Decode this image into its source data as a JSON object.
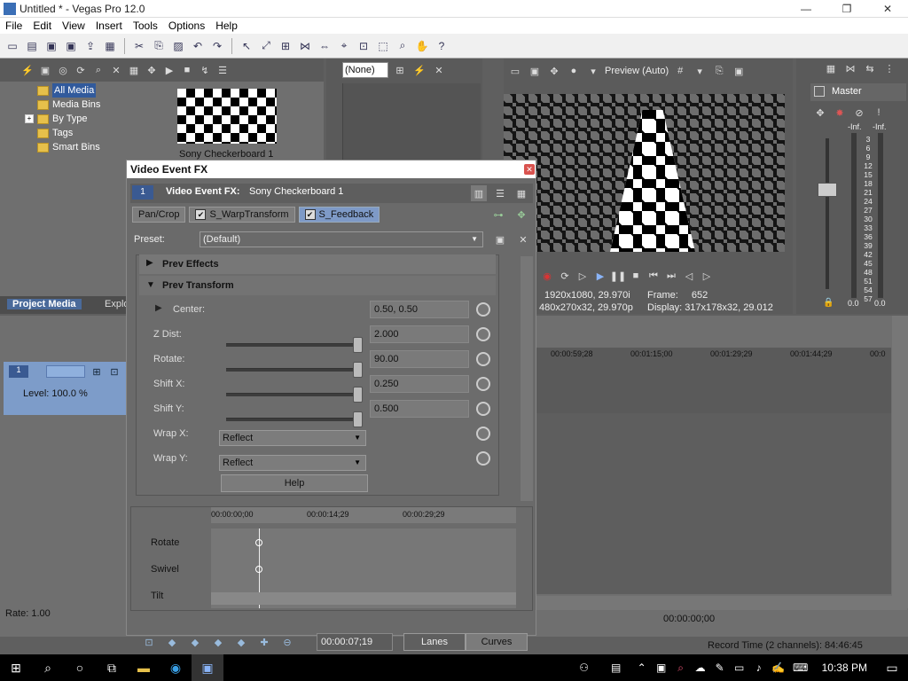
{
  "window": {
    "title": "Untitled * - Vegas Pro 12.0",
    "minimize": "—",
    "maximize": "❐",
    "close": "✕"
  },
  "menu": [
    "File",
    "Edit",
    "View",
    "Insert",
    "Tools",
    "Options",
    "Help"
  ],
  "media_tree": {
    "items": [
      {
        "label": "All Media",
        "selected": true
      },
      {
        "label": "Media Bins"
      },
      {
        "label": "By Type",
        "expand": "+"
      },
      {
        "label": "Tags"
      },
      {
        "label": "Smart Bins"
      }
    ],
    "thumbnail_caption": "Sony Checkerboard 1",
    "tabs": [
      "Project Media",
      "Explo"
    ]
  },
  "trimmer": {
    "none_select": "(None)"
  },
  "preview": {
    "quality": "Preview (Auto)",
    "info": {
      "project": "1920x1080, 29.970i",
      "preview": "480x270x32, 29.970p",
      "frame_label": "Frame:",
      "frame_value": "652",
      "display_label": "Display:",
      "display_value": "317x178x32, 29.012"
    }
  },
  "master": {
    "title": "Master",
    "inf_left": "-Inf.",
    "inf_right": "-Inf.",
    "scale": [
      "3",
      "6",
      "9",
      "12",
      "15",
      "18",
      "21",
      "24",
      "27",
      "30",
      "33",
      "36",
      "39",
      "42",
      "45",
      "48",
      "51",
      "54",
      "57"
    ],
    "bottom_left": "0.0",
    "bottom_right": "0.0"
  },
  "timeline": {
    "ruler": [
      "00:00:59;28",
      "00:01:15;00",
      "00:01:29;29",
      "00:01:44;29",
      "00:0"
    ],
    "track_level": "Level: 100.0 %",
    "track_number": "1",
    "rate": "Rate: 1.00",
    "time_readout": "00:00:00;00",
    "record_time": "Record Time (2 channels): 84:46:45"
  },
  "dialog": {
    "title": "Video Event FX",
    "number": "1",
    "fx_label": "Video Event FX:",
    "fx_target": "Sony Checkerboard 1",
    "chain": [
      {
        "label": "Pan/Crop",
        "checkbox": false,
        "active": false
      },
      {
        "label": "S_WarpTransform",
        "checkbox": true,
        "active": false
      },
      {
        "label": "S_Feedback",
        "checkbox": true,
        "active": true
      }
    ],
    "preset_label": "Preset:",
    "preset_value": "(Default)",
    "sections": {
      "prev_effects": "Prev Effects",
      "prev_transform": "Prev Transform"
    },
    "params": {
      "center": {
        "label": "Center:",
        "value": "0.50, 0.50"
      },
      "zdist": {
        "label": "Z Dist:",
        "value": "2.000"
      },
      "rotate": {
        "label": "Rotate:",
        "value": "90.00"
      },
      "shiftx": {
        "label": "Shift X:",
        "value": "0.250"
      },
      "shifty": {
        "label": "Shift Y:",
        "value": "0.500"
      },
      "wrapx": {
        "label": "Wrap X:",
        "value": "Reflect"
      },
      "wrapy": {
        "label": "Wrap Y:",
        "value": "Reflect"
      }
    },
    "help": "Help",
    "keyframes": {
      "ruler": [
        "00:00:00;00",
        "00:00:14;29",
        "00:00:29;29"
      ],
      "tracks": [
        "Rotate",
        "Swivel",
        "Tilt"
      ],
      "time": "00:00:07;19",
      "lanes": "Lanes",
      "curves": "Curves"
    }
  },
  "taskbar": {
    "clock": "10:38 PM"
  }
}
